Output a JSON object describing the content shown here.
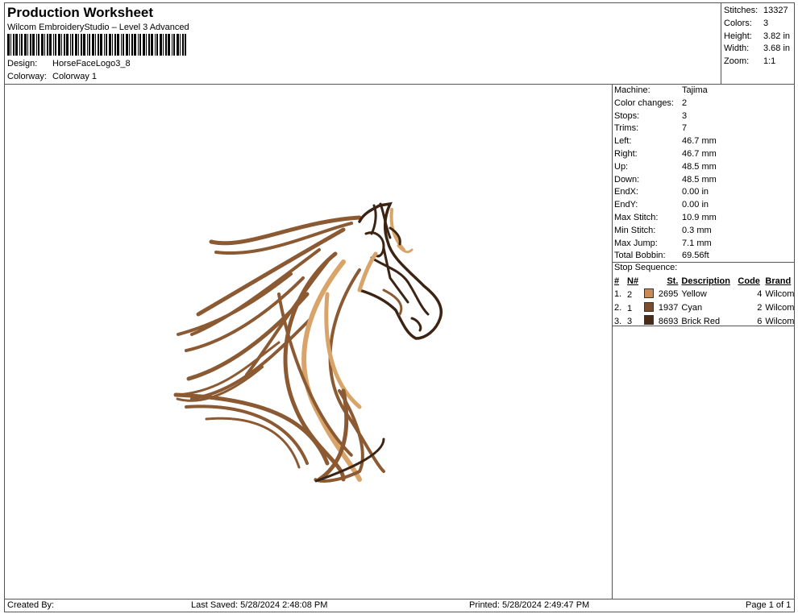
{
  "header": {
    "title": "Production Worksheet",
    "software": "Wilcom EmbroideryStudio – Level 3 Advanced",
    "design_label": "Design:",
    "design_value": "HorseFaceLogo3_8",
    "colorway_label": "Colorway:",
    "colorway_value": "Colorway 1"
  },
  "stats": [
    {
      "label": "Stitches:",
      "value": "13327"
    },
    {
      "label": "Colors:",
      "value": "3"
    },
    {
      "label": "Height:",
      "value": "3.82 in"
    },
    {
      "label": "Width:",
      "value": "3.68 in"
    },
    {
      "label": "Zoom:",
      "value": "1:1"
    }
  ],
  "machine_info": [
    {
      "label": "Machine:",
      "value": "Tajima"
    },
    {
      "label": "Color changes:",
      "value": "2"
    },
    {
      "label": "Stops:",
      "value": "3"
    },
    {
      "label": "Trims:",
      "value": "7"
    },
    {
      "label": "Left:",
      "value": "46.7 mm"
    },
    {
      "label": "Right:",
      "value": "46.7 mm"
    },
    {
      "label": "Up:",
      "value": "48.5 mm"
    },
    {
      "label": "Down:",
      "value": "48.5 mm"
    },
    {
      "label": "EndX:",
      "value": "0.00 in"
    },
    {
      "label": "EndY:",
      "value": "0.00 in"
    },
    {
      "label": "Max Stitch:",
      "value": "10.9 mm"
    },
    {
      "label": "Min Stitch:",
      "value": "0.3 mm"
    },
    {
      "label": "Max Jump:",
      "value": "7.1 mm"
    },
    {
      "label": "Total Bobbin:",
      "value": "69.56ft"
    }
  ],
  "stop_sequence": {
    "label": "Stop Sequence:",
    "columns": [
      "#",
      "N#",
      "St.",
      "Description",
      "Code",
      "Brand"
    ],
    "rows": [
      {
        "idx": "1.",
        "n": "2",
        "color": "#c98a55",
        "st": "2695",
        "desc": "Yellow",
        "code": "4",
        "brand": "Wilcom"
      },
      {
        "idx": "2.",
        "n": "1",
        "color": "#7a4e2c",
        "st": "1937",
        "desc": "Cyan",
        "code": "2",
        "brand": "Wilcom"
      },
      {
        "idx": "3.",
        "n": "3",
        "color": "#4a2a18",
        "st": "8693",
        "desc": "Brick Red",
        "code": "6",
        "brand": "Wilcom"
      }
    ]
  },
  "footer": {
    "created_by": "Created By:",
    "last_saved": "Last Saved: 5/28/2024 2:48:08 PM",
    "printed": "Printed: 5/28/2024 2:49:47 PM",
    "page": "Page 1 of 1"
  },
  "design_colors": {
    "light": "#d9a46a",
    "mid": "#8b5a33",
    "dark": "#3b2414"
  }
}
